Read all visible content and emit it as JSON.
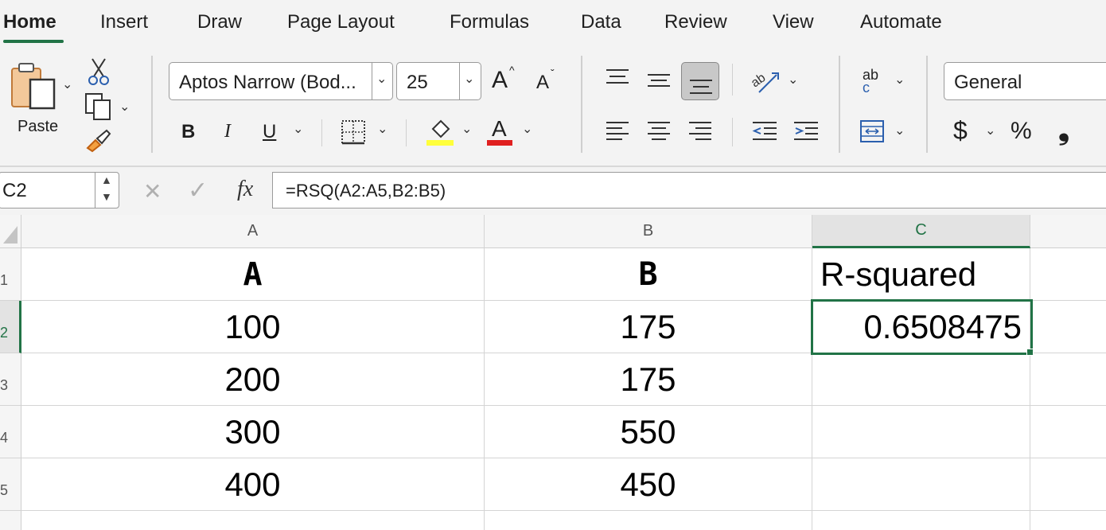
{
  "ribbon": {
    "tabs": [
      "Home",
      "Insert",
      "Draw",
      "Page Layout",
      "Formulas",
      "Data",
      "Review",
      "View",
      "Automate"
    ],
    "paste_label": "Paste",
    "font_name": "Aptos Narrow (Bod...",
    "font_size": "25",
    "number_format": "General",
    "bold_label": "B",
    "italic_label": "I",
    "underline_label": "U",
    "grow_font_label": "A",
    "shrink_font_label": "A",
    "font_color_label": "A",
    "currency_label": "$",
    "percent_label": "%",
    "comma_label": "❟",
    "wrap_label_top": "ab",
    "wrap_label_bottom": "c",
    "fill_color": "#ffff3b",
    "font_color": "#e02020"
  },
  "formula_bar": {
    "name_box": "C2",
    "cancel_icon": "✕",
    "enter_icon": "✓",
    "fx_label": "fx",
    "formula": "=RSQ(A2:A5,B2:B5)"
  },
  "sheet": {
    "columns": [
      "A",
      "B",
      "C"
    ],
    "rows": [
      "1",
      "2",
      "3",
      "4",
      "5"
    ],
    "cells": {
      "A1": "A",
      "B1": "B",
      "C1": "R-squared",
      "A2": "100",
      "B2": "175",
      "C2": "0.6508475",
      "A3": "200",
      "B3": "175",
      "C3": "",
      "A4": "300",
      "B4": "550",
      "C4": "",
      "A5": "400",
      "B5": "450",
      "C5": ""
    },
    "active_cell": "C2",
    "accent_color": "#217346"
  }
}
